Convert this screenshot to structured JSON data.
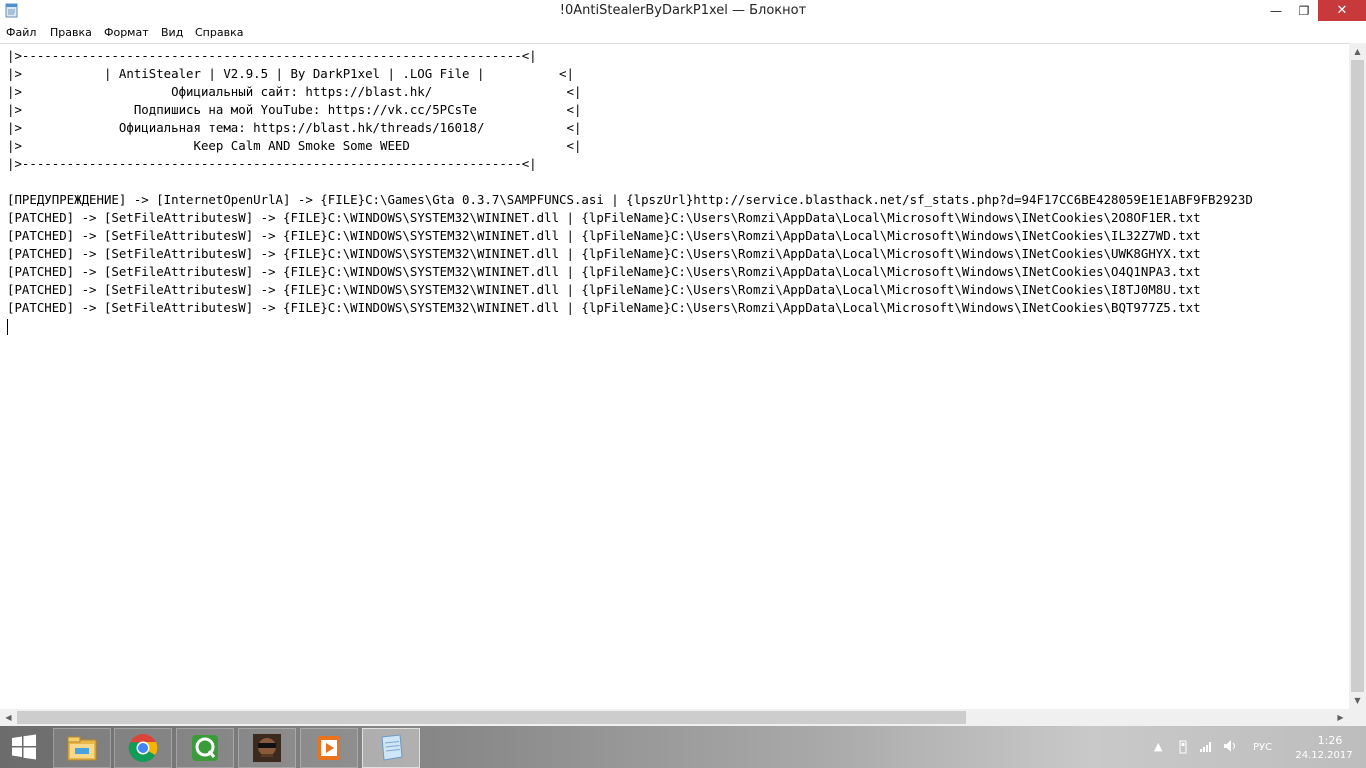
{
  "window": {
    "title": "!0AntiStealerByDarkP1xel — Блокнот",
    "minimize_glyph": "—",
    "maximize_glyph": "❐",
    "close_glyph": "✕"
  },
  "menu": {
    "file": "Файл",
    "edit": "Правка",
    "format": "Формат",
    "view": "Вид",
    "help": "Справка"
  },
  "editor": {
    "text": "|>-------------------------------------------------------------------<|\n|>           | AntiStealer | V2.9.5 | By DarkP1xel | .LOG File |          <|\n|>                    Официальный сайт: https://blast.hk/                  <|\n|>               Подпишись на мой YouTube: https://vk.cc/5PCsTe            <|\n|>             Официальная тема: https://blast.hk/threads/16018/           <|\n|>                       Keep Calm AND Smoke Some WEED                     <|\n|>-------------------------------------------------------------------<|\n\n[ПРЕДУПРЕЖДЕНИЕ] -> [InternetOpenUrlA] -> {FILE}C:\\Games\\Gta 0.3.7\\SAMPFUNCS.asi | {lpszUrl}http://service.blasthack.net/sf_stats.php?d=94F17CC6BE428059E1E1ABF9FB2923D\n[PATCHED] -> [SetFileAttributesW] -> {FILE}C:\\WINDOWS\\SYSTEM32\\WININET.dll | {lpFileName}C:\\Users\\Romzi\\AppData\\Local\\Microsoft\\Windows\\INetCookies\\2O8OF1ER.txt\n[PATCHED] -> [SetFileAttributesW] -> {FILE}C:\\WINDOWS\\SYSTEM32\\WININET.dll | {lpFileName}C:\\Users\\Romzi\\AppData\\Local\\Microsoft\\Windows\\INetCookies\\IL32Z7WD.txt\n[PATCHED] -> [SetFileAttributesW] -> {FILE}C:\\WINDOWS\\SYSTEM32\\WININET.dll | {lpFileName}C:\\Users\\Romzi\\AppData\\Local\\Microsoft\\Windows\\INetCookies\\UWK8GHYX.txt\n[PATCHED] -> [SetFileAttributesW] -> {FILE}C:\\WINDOWS\\SYSTEM32\\WININET.dll | {lpFileName}C:\\Users\\Romzi\\AppData\\Local\\Microsoft\\Windows\\INetCookies\\O4Q1NPA3.txt\n[PATCHED] -> [SetFileAttributesW] -> {FILE}C:\\WINDOWS\\SYSTEM32\\WININET.dll | {lpFileName}C:\\Users\\Romzi\\AppData\\Local\\Microsoft\\Windows\\INetCookies\\I8TJ0M8U.txt\n[PATCHED] -> [SetFileAttributesW] -> {FILE}C:\\WINDOWS\\SYSTEM32\\WININET.dll | {lpFileName}C:\\Users\\Romzi\\AppData\\Local\\Microsoft\\Windows\\INetCookies\\BQT977Z5.txt\n"
  },
  "scrollbars": {
    "up_glyph": "▲",
    "down_glyph": "▼",
    "left_glyph": "◀",
    "right_glyph": "▶"
  },
  "taskbar": {
    "language": "РУС",
    "time": "1:26",
    "date": "24.12.2017",
    "tray_up_glyph": "▲"
  },
  "icons": {
    "app": "notepad-icon",
    "start": "windows-logo-icon",
    "explorer": "folder-icon",
    "chrome": "chrome-icon",
    "qip": "qip-icon",
    "game": "gta-icon",
    "media": "media-player-icon",
    "notepad": "notepad-icon"
  },
  "colors": {
    "close_button": "#c7393a",
    "accent": "#1e88e5"
  }
}
